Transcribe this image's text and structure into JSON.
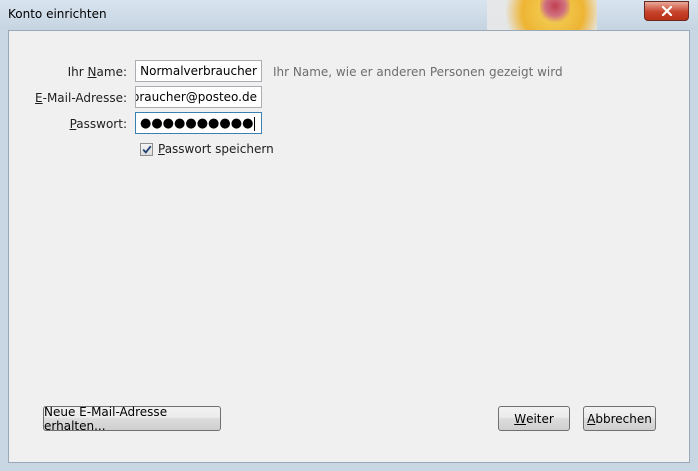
{
  "window": {
    "title": "Konto einrichten"
  },
  "form": {
    "name": {
      "label_accel": "N",
      "label_pre": "Ihr ",
      "label_post": "ame:",
      "value": "Otto Normalverbraucher",
      "hint": "Ihr Name, wie er anderen Personen gezeigt wird"
    },
    "email": {
      "label_accel": "E",
      "label_post": "-Mail-Adresse:",
      "value": "otto.normalverbraucher@posteo.de"
    },
    "password": {
      "label_accel": "P",
      "label_post": "asswort:",
      "masked_value": "●●●●●●●●●●"
    },
    "save_password": {
      "label_accel": "P",
      "label_post": "asswort speichern",
      "checked": true
    }
  },
  "buttons": {
    "new_address": "Neue E-Mail-Adresse erhalten...",
    "next_accel": "W",
    "next_post": "eiter",
    "cancel_accel": "A",
    "cancel_post": "bbrechen"
  },
  "colors": {
    "close_button": "#c7432c",
    "focus_border": "#3c7fb1"
  },
  "icons": {
    "close": "close-icon",
    "check": "checkmark-icon"
  }
}
